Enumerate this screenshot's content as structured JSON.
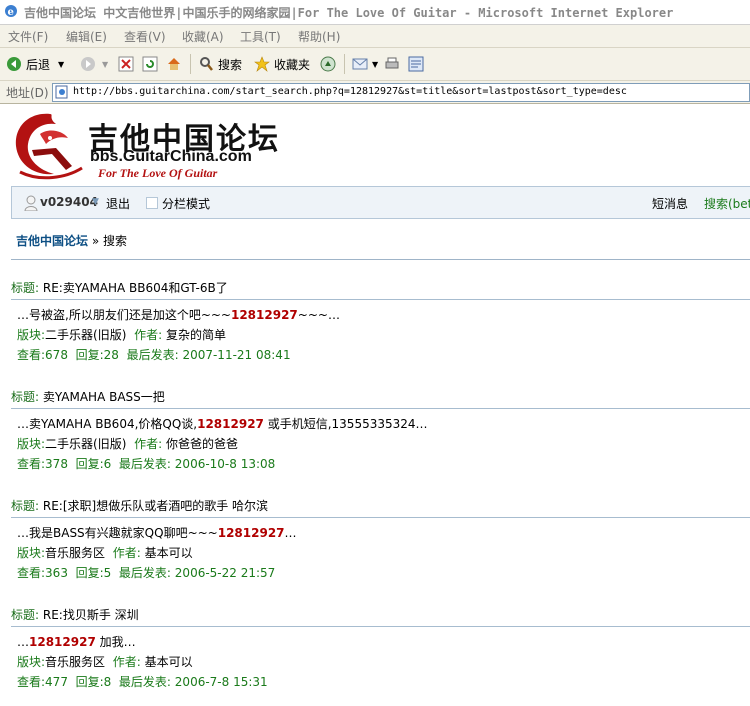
{
  "window": {
    "title": "吉他中国论坛 中文吉他世界|中国乐手的网络家园|For The Love Of Guitar - Microsoft Internet Explorer"
  },
  "menu": {
    "file": "文件(F)",
    "edit": "编辑(E)",
    "view": "查看(V)",
    "favorites": "收藏(A)",
    "tools": "工具(T)",
    "help": "帮助(H)"
  },
  "toolbar": {
    "back": "后退",
    "search": "搜索",
    "favorites": "收藏夹"
  },
  "address": {
    "label": "地址(D)",
    "url": "http://bbs.guitarchina.com/start_search.php?q=12812927&st=title&sort=lastpost&sort_type=desc"
  },
  "site": {
    "logo_zh": "吉他中国论坛",
    "logo_en": "bbs.GuitarChina.com",
    "logo_tagline": "For The Love Of Guitar"
  },
  "userbar": {
    "username": "v029404",
    "logout": "退出",
    "split_mode": "分栏模式",
    "messages": "短消息",
    "search": "搜索(bet"
  },
  "breadcrumb": {
    "home": "吉他中国论坛",
    "current": "» 搜索"
  },
  "labels": {
    "title": "标题:",
    "forum": "版块:",
    "author": "作者:",
    "views": "查看:",
    "replies": "回复:",
    "last_post": "最后发表:"
  },
  "results": [
    {
      "title": "RE:卖YAMAHA BB604和GT-6B了",
      "snippet_before": "…号被盗,所以朋友们还是加这个吧~~~",
      "keyword": "12812927",
      "snippet_after": "~~~…",
      "forum": "二手乐器(旧版)",
      "author": "复杂的简单",
      "views": "678",
      "replies": "28",
      "last_post": "2007-11-21 08:41"
    },
    {
      "title": "卖YAMAHA BASS一把",
      "snippet_before": "…卖YAMAHA BB604,价格QQ谈,",
      "keyword": "12812927",
      "snippet_after": " 或手机短信,13555335324…",
      "forum": "二手乐器(旧版)",
      "author": "你爸爸的爸爸",
      "views": "378",
      "replies": "6",
      "last_post": "2006-10-8 13:08"
    },
    {
      "title": "RE:[求职]想做乐队或者酒吧的歌手  哈尔滨",
      "snippet_before": "…我是BASS有兴趣就家QQ聊吧~~~",
      "keyword": "12812927",
      "snippet_after": "…",
      "forum": "音乐服务区",
      "author": "基本可以",
      "views": "363",
      "replies": "5",
      "last_post": "2006-5-22 21:57"
    },
    {
      "title": "RE:找贝斯手  深圳",
      "snippet_before": "…",
      "keyword": "12812927",
      "snippet_after": " 加我…",
      "forum": "音乐服务区",
      "author": "基本可以",
      "views": "477",
      "replies": "8",
      "last_post": "2006-7-8 15:31"
    }
  ]
}
